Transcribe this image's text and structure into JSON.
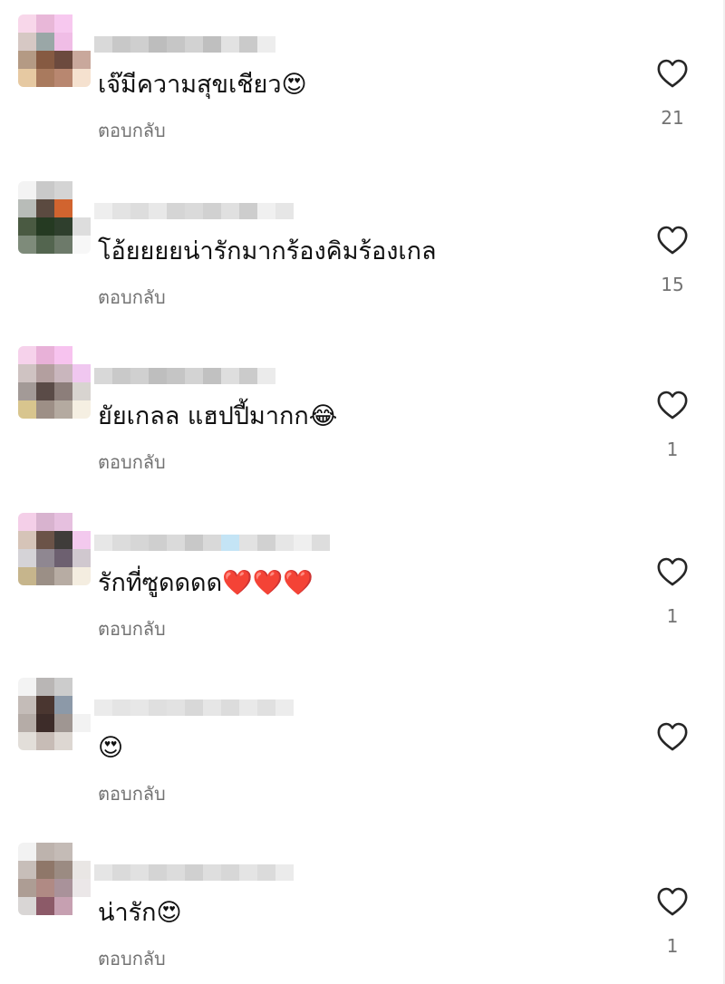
{
  "comments": [
    {
      "text": "เจ๊มีความสุขเชียว😍",
      "reply_label": "ตอบกลับ",
      "likes": "21",
      "avatar_colors": [
        "#f8d7ea",
        "#e8b7d8",
        "#f7c8ef",
        "#ffffff",
        "#d6c8c4",
        "#9aa7a7",
        "#f0bde6",
        "#ffffff",
        "#b49a84",
        "#865a42",
        "#6c4a3e",
        "#c9a89c",
        "#e6c9a2",
        "#a97a5e",
        "#b88770",
        "#f5e1cf"
      ],
      "name_colors": [
        "#d9d9d9",
        "#c8c8c8",
        "#cfcfcf",
        "#bdbdbd",
        "#c6c6c6",
        "#d2d2d2",
        "#bfbfbf",
        "#e2e2e2",
        "#cacaca",
        "#ededed"
      ]
    },
    {
      "text": "โอ้ยยยยน่ารักมากร้องคิมร้องเกล",
      "reply_label": "ตอบกลับ",
      "likes": "15",
      "avatar_colors": [
        "#f3f3f3",
        "#c9c9c9",
        "#d4d4d4",
        "#ffffff",
        "#b8bcb8",
        "#5b4a40",
        "#d1642f",
        "#ffffff",
        "#4a5a42",
        "#253a22",
        "#2f3f2d",
        "#dddddd",
        "#7e8b7a",
        "#53654f",
        "#6d7a6a",
        "#f7f7f7"
      ],
      "name_colors": [
        "#eeeeee",
        "#e3e3e3",
        "#dddddd",
        "#e8e8e8",
        "#d5d5d5",
        "#dadada",
        "#d1d1d1",
        "#e0e0e0",
        "#cdcdcd",
        "#f0f0f0",
        "#e6e6e6"
      ]
    },
    {
      "text": "ยัยเกลล แฮปปี้มากก😂",
      "reply_label": "ตอบกลับ",
      "likes": "1",
      "avatar_colors": [
        "#f6d2eb",
        "#e8b1d8",
        "#f7c3ef",
        "#ffffff",
        "#cfc3c2",
        "#b39f9f",
        "#c9b6bd",
        "#f0c7f0",
        "#a39a97",
        "#5a4b47",
        "#8c7e7a",
        "#d8d4d0",
        "#d8c58e",
        "#9d8f86",
        "#b4aaa0",
        "#f5efe2"
      ],
      "name_colors": [
        "#d8d8d8",
        "#c9c9c9",
        "#d0d0d0",
        "#bebebe",
        "#c5c5c5",
        "#d3d3d3",
        "#c1c1c1",
        "#dedede",
        "#cbcbcb",
        "#ebebeb"
      ]
    },
    {
      "text": "รักที่ซูดดดด❤️❤️❤️",
      "reply_label": "ตอบกลับ",
      "likes": "1",
      "avatar_colors": [
        "#f4cfe8",
        "#d8b3cf",
        "#e6c0df",
        "#ffffff",
        "#d6c4b8",
        "#6b5348",
        "#3f3c3a",
        "#f3c9ee",
        "#d5d3d7",
        "#8f8791",
        "#6d6070",
        "#d0c8cf",
        "#c6b58c",
        "#9b8f86",
        "#b7aca3",
        "#f4ede0"
      ],
      "name_colors": [
        "#e7e7e7",
        "#dcdcdc",
        "#d6d6d6",
        "#cfcfcf",
        "#dadada",
        "#c8c8c8",
        "#d9d9d9",
        "#c4e4f5",
        "#e2e2e2",
        "#d1d1d1",
        "#e6e6e6",
        "#efefef",
        "#dddddd"
      ]
    },
    {
      "text": "😍",
      "reply_label": "ตอบกลับ",
      "likes": "",
      "avatar_colors": [
        "#f3f3f3",
        "#b9b6b5",
        "#cccccc",
        "#ffffff",
        "#c4bcb8",
        "#4a3630",
        "#8c99a8",
        "#ffffff",
        "#b5aca7",
        "#3d2c29",
        "#9f9692",
        "#f2f2f2",
        "#e2ded9",
        "#c7bcb6",
        "#ddd7d2",
        "#ffffff"
      ],
      "name_colors": [
        "#ebebeb",
        "#e4e4e4",
        "#e7e7e7",
        "#dfdfdf",
        "#e2e2e2",
        "#d8d8d8",
        "#e6e6e6",
        "#dcdcdc",
        "#e9e9e9",
        "#e0e0e0",
        "#ececec"
      ]
    },
    {
      "text": "น่ารัก😍",
      "reply_label": "ตอบกลับ",
      "likes": "1",
      "avatar_colors": [
        "#f2f2f2",
        "#bdb3ad",
        "#c4bbb6",
        "#ffffff",
        "#c7beb9",
        "#8f7769",
        "#9b8b82",
        "#e9e6e4",
        "#ad9d94",
        "#b08a84",
        "#a9929a",
        "#ebe7e8",
        "#d9d6d5",
        "#8c5a68",
        "#c6a0b1",
        "#ffffff"
      ],
      "name_colors": [
        "#e5e5e5",
        "#dadada",
        "#e1e1e1",
        "#d4d4d4",
        "#dcdcdc",
        "#d0d0d0",
        "#dedede",
        "#d7d7d7",
        "#e4e4e4",
        "#dbdbdb",
        "#ebebeb"
      ]
    }
  ],
  "like_icon": "heart-outline-icon",
  "colors": {
    "text": "#111111",
    "secondary": "#737373",
    "icon": "#262626"
  }
}
